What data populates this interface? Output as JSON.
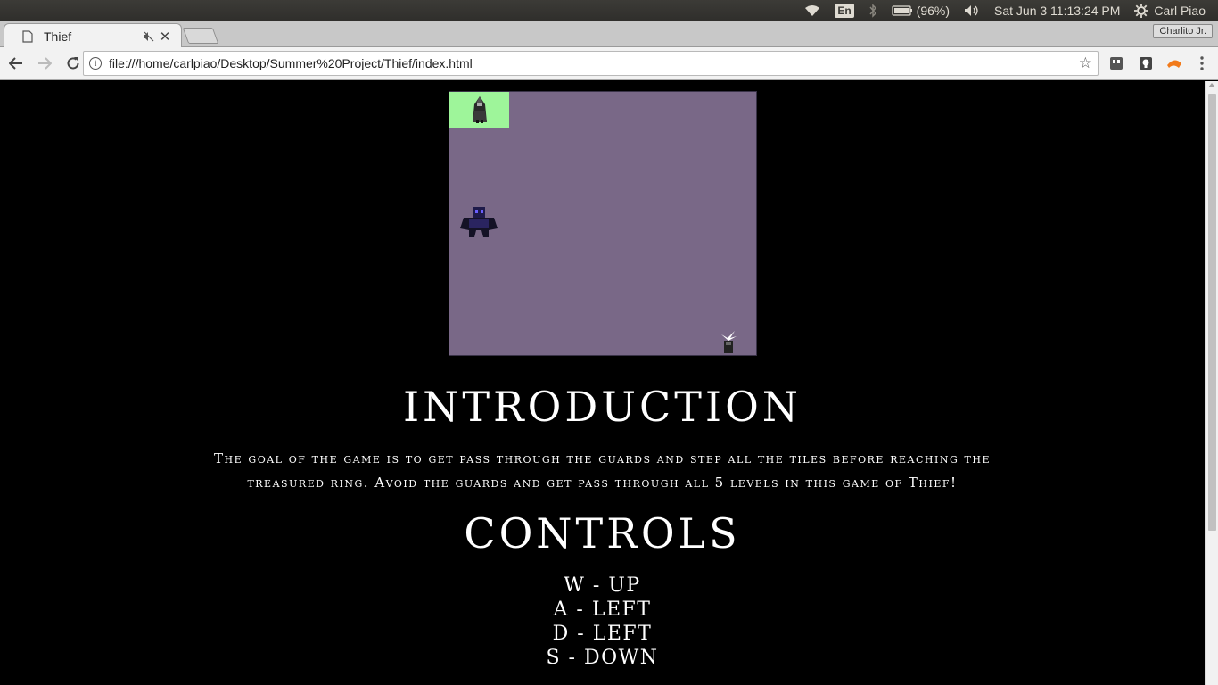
{
  "os_panel": {
    "language": "En",
    "battery": "(96%)",
    "clock": "Sat Jun  3 11:13:24 PM",
    "user": "Carl Piao"
  },
  "browser": {
    "tab_title": "Thief",
    "profile": "Charlito Jr.",
    "url": "file:///home/carlpiao/Desktop/Summer%20Project/Thief/index.html"
  },
  "game": {
    "tile_color": "#796887",
    "visited_color": "#9ef59a",
    "sprites": [
      "thief-sprite",
      "guard-sprite",
      "ring-sprite"
    ]
  },
  "intro": {
    "heading": "INTRODUCTION",
    "text": "The goal of the game is to get pass through the guards and step all the tiles before reaching the treasured ring. Avoid the guards and get pass through all 5 levels in this game of Thief!"
  },
  "controls": {
    "heading": "CONTROLS",
    "lines": [
      "W - UP",
      "A - LEFT",
      "D - LEFT",
      "S - DOWN"
    ]
  }
}
